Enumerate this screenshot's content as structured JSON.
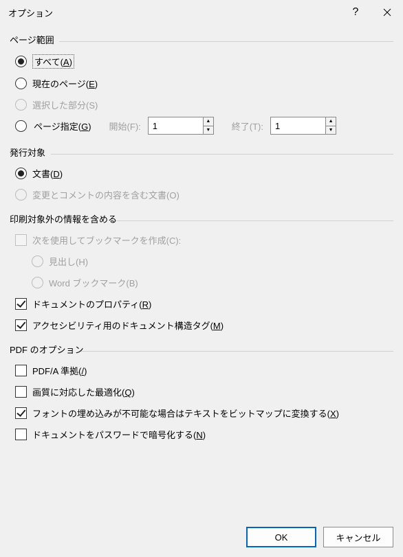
{
  "title": "オプション",
  "pageRange": {
    "group": "ページ範囲",
    "all": "すべて(",
    "allKey": "A",
    "allEnd": ")",
    "current": "現在のページ(",
    "currentKey": "E",
    "currentEnd": ")",
    "selection": "選択した部分(S)",
    "pages": "ページ指定(",
    "pagesKey": "G",
    "pagesEnd": ")",
    "from": "開始(F):",
    "to": "終了(T):",
    "fromVal": "1",
    "toVal": "1"
  },
  "publish": {
    "group": "発行対象",
    "doc": "文書(",
    "docKey": "D",
    "docEnd": ")",
    "markup": "変更とコメントの内容を含む文書(O)"
  },
  "nonprint": {
    "group": "印刷対象外の情報を含める",
    "createBm": "次を使用してブックマークを作成(C):",
    "headings": "見出し(H)",
    "wordBm": "Word ブックマーク(B)",
    "props": "ドキュメントのプロパティ(",
    "propsKey": "R",
    "propsEnd": ")",
    "tags": "アクセシビリティ用のドキュメント構造タグ(",
    "tagsKey": "M",
    "tagsEnd": ")"
  },
  "pdf": {
    "group": "PDF のオプション",
    "pdfa": "PDF/A 準拠(",
    "pdfaKey": "/",
    "pdfaEnd": ")",
    "opt": "画質に対応した最適化(",
    "optKey": "Q",
    "optEnd": ")",
    "bitmap": "フォントの埋め込みが不可能な場合はテキストをビットマップに変換する(",
    "bitmapKey": "X",
    "bitmapEnd": ")",
    "encrypt": "ドキュメントをパスワードで暗号化する(",
    "encryptKey": "N",
    "encryptEnd": ")"
  },
  "buttons": {
    "ok": "OK",
    "cancel": "キャンセル"
  }
}
